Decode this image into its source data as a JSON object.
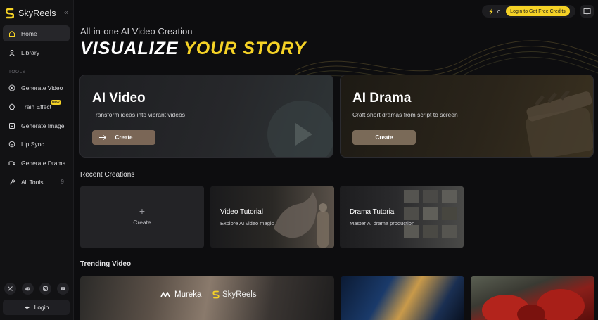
{
  "brand": {
    "name": "SkyReels",
    "collapse_icon": "chevrons-left-icon"
  },
  "sidebar": {
    "nav": [
      {
        "label": "Home",
        "icon": "home-icon",
        "active": true
      },
      {
        "label": "Library",
        "icon": "user-icon",
        "active": false
      }
    ],
    "tools_heading": "TOOLS",
    "tools": [
      {
        "label": "Generate Video",
        "icon": "play-circle-icon"
      },
      {
        "label": "Train Effect",
        "icon": "sparkle-icon",
        "badge": "NEW"
      },
      {
        "label": "Generate Image",
        "icon": "image-icon"
      },
      {
        "label": "Lip Sync",
        "icon": "lips-icon"
      },
      {
        "label": "Generate Drama",
        "icon": "camera-icon"
      },
      {
        "label": "All Tools",
        "icon": "wrench-icon",
        "count": "9"
      }
    ],
    "socials": [
      "x-icon",
      "discord-icon",
      "instagram-icon",
      "youtube-icon"
    ],
    "login_label": "Login"
  },
  "header": {
    "credits_value": "0",
    "credits_cta": "Login to Get Free Credits",
    "book_icon": "book-icon"
  },
  "hero": {
    "subtitle": "All-in-one AI Video Creation",
    "headline_white": "VISUALIZE ",
    "headline_yellow": "YOUR STORY"
  },
  "features": [
    {
      "title": "AI Video",
      "desc": "Transform ideas into vibrant videos",
      "button": "Create"
    },
    {
      "title": "AI Drama",
      "desc": "Craft short dramas from script to screen",
      "button": "Create"
    }
  ],
  "recent": {
    "heading": "Recent Creations",
    "create_label": "Create",
    "tiles": [
      {
        "title": "Video Tutorial",
        "sub": "Explore AI video magic"
      },
      {
        "title": "Drama Tutorial",
        "sub": "Master AI drama production"
      }
    ]
  },
  "trending": {
    "heading": "Trending Video",
    "partner_1": "Mureka",
    "partner_2": "SkyReels"
  },
  "colors": {
    "accent": "#f5d226",
    "background": "#0d0d0f",
    "button_brown": "#7a6656"
  }
}
